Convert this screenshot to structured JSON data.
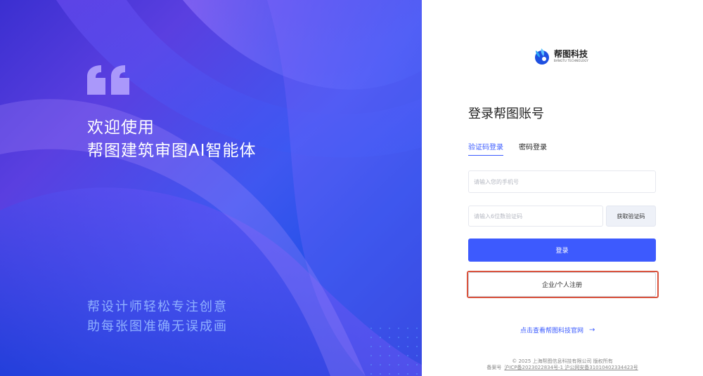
{
  "left": {
    "welcome_line1": "欢迎使用",
    "welcome_line2": "帮图建筑审图AI智能体",
    "slogan_line1": "帮设计师轻松专注创意",
    "slogan_line2": "助每张图准确无误成画"
  },
  "logo": {
    "name_cn": "帮图科技",
    "name_en": "BANGTU TECHNOLOGY"
  },
  "login": {
    "title": "登录帮图账号",
    "tab_sms": "验证码登录",
    "tab_password": "密码登录",
    "phone_placeholder": "请输入您的手机号",
    "code_placeholder": "请输入6位数验证码",
    "get_code": "获取验证码",
    "login_button": "登录",
    "register_button": "企业/个人注册",
    "official_link": "点击查看帮图科技官网",
    "official_arrow": "→"
  },
  "footer": {
    "copyright": "© 2025 上海帮图信息科技有限公司 版权所有",
    "record_label": "备案号",
    "icp": "沪ICP备2023022834号-1 沪公网安备31010402334423号"
  },
  "colors": {
    "accent": "#3d5afe",
    "highlight_border": "#d9533d"
  }
}
